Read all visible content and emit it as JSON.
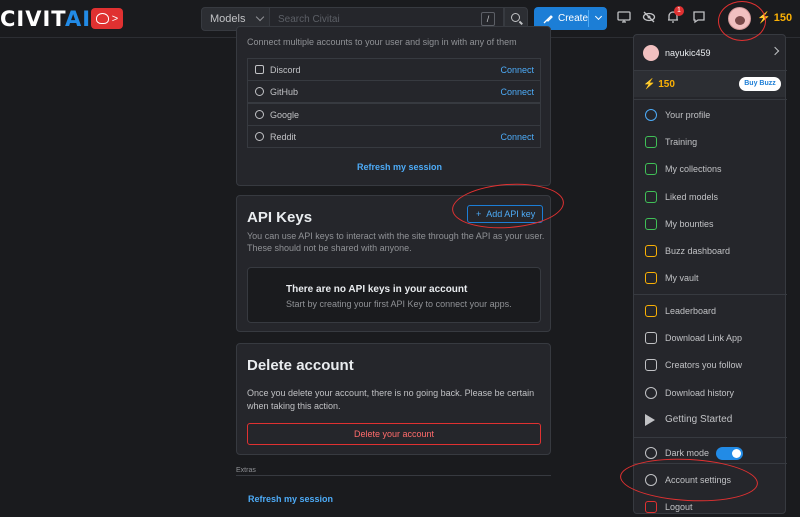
{
  "topbar": {
    "logo_main": "CIVIT",
    "logo_ai": "AI",
    "heart_chevron": ">",
    "search_type": "Models",
    "search_placeholder": "Search Civitai",
    "search_shortcut": "/",
    "create_label": "Create",
    "notification_count": "1",
    "buzz_amount": "150"
  },
  "connected": {
    "description": "Connect multiple accounts to your user and sign in with any of them",
    "accounts": [
      {
        "name": "Discord",
        "action": "Connect"
      },
      {
        "name": "GitHub",
        "action": "Connect"
      },
      {
        "name": "Google",
        "action": ""
      },
      {
        "name": "Reddit",
        "action": "Connect"
      }
    ],
    "refresh_label": "Refresh my session"
  },
  "api_keys": {
    "title": "API Keys",
    "add_label": "Add API key",
    "description": "You can use API keys to interact with the site through the API as your user. These should not be shared with anyone.",
    "empty_title": "There are no API keys in your account",
    "empty_text": "Start by creating your first API Key to connect your apps."
  },
  "delete_account": {
    "title": "Delete account",
    "description": "Once you delete your account, there is no going back. Please be certain when taking this action.",
    "button_label": "Delete your account"
  },
  "extras": {
    "label": "Extras",
    "refresh_label": "Refresh my session"
  },
  "menu": {
    "username": "nayukic459",
    "buzz_amount": "150",
    "buy_buzz_label": "Buy Buzz",
    "items": [
      {
        "label": "Your profile",
        "icon": "user-icon",
        "color": "#4dabf7"
      },
      {
        "label": "Training",
        "icon": "barbell-icon",
        "color": "#40c057"
      },
      {
        "label": "My collections",
        "icon": "bookmark-icon",
        "color": "#40c057"
      },
      {
        "label": "Liked models",
        "icon": "thumb-up-icon",
        "color": "#40c057"
      },
      {
        "label": "My bounties",
        "icon": "moneybag-icon",
        "color": "#40c057"
      },
      {
        "label": "Buzz dashboard",
        "icon": "bolt-icon",
        "color": "#fab005"
      },
      {
        "label": "My vault",
        "icon": "cloud-lock-icon",
        "color": "#fab005"
      },
      {
        "label": "Leaderboard",
        "icon": "crown-icon",
        "color": "#fab005"
      },
      {
        "label": "Download Link App",
        "icon": "link-icon",
        "color": "#c1c2c5"
      },
      {
        "label": "Creators you follow",
        "icon": "playlist-add-icon",
        "color": "#c1c2c5"
      },
      {
        "label": "Download history",
        "icon": "history-icon",
        "color": "#c1c2c5"
      },
      {
        "label": "Getting Started",
        "icon": "play-icon",
        "color": "#c1c2c5"
      },
      {
        "label": "Dark mode",
        "icon": "palette-icon",
        "color": "#c1c2c5"
      },
      {
        "label": "Account settings",
        "icon": "gear-icon",
        "color": "#c1c2c5"
      },
      {
        "label": "Logout",
        "icon": "logout-icon",
        "color": "#e03131"
      }
    ]
  },
  "colors": {
    "accent": "#228be6",
    "danger": "#e03131",
    "buzz": "#fab005",
    "annotation": "#e03131"
  }
}
